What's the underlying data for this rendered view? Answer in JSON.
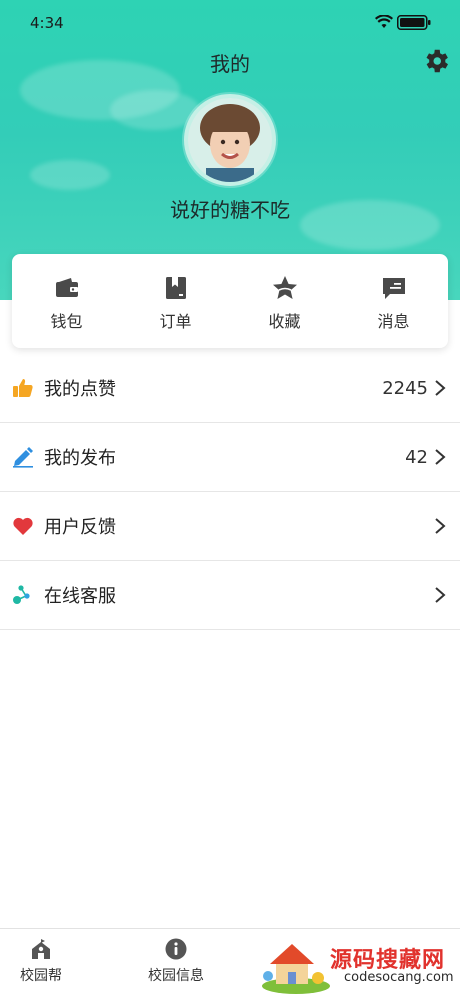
{
  "status_bar": {
    "time": "4:34"
  },
  "header": {
    "title": "我的",
    "username": "说好的糖不吃"
  },
  "quick_actions": [
    {
      "label": "钱包",
      "icon": "wallet-icon"
    },
    {
      "label": "订单",
      "icon": "order-icon"
    },
    {
      "label": "收藏",
      "icon": "star-icon"
    },
    {
      "label": "消息",
      "icon": "message-icon"
    }
  ],
  "menu": [
    {
      "label": "我的点赞",
      "value": "2245",
      "icon": "thumbs-up-icon",
      "color": "#f5a623"
    },
    {
      "label": "我的发布",
      "value": "42",
      "icon": "pencil-icon",
      "color": "#2f8fe0"
    },
    {
      "label": "用户反馈",
      "value": "",
      "icon": "heart-icon",
      "color": "#e2383c"
    },
    {
      "label": "在线客服",
      "value": "",
      "icon": "share-nodes-icon",
      "color": "#1fb8a4"
    }
  ],
  "tabs": [
    {
      "label": "校园帮",
      "icon": "school-icon"
    },
    {
      "label": "校园信息",
      "icon": "info-icon"
    }
  ],
  "watermark": {
    "title": "源码搜藏网",
    "url": "codesocang.com"
  },
  "colors": {
    "header": "#33cdb8",
    "text": "#222222",
    "divider": "#e6e6e6"
  }
}
